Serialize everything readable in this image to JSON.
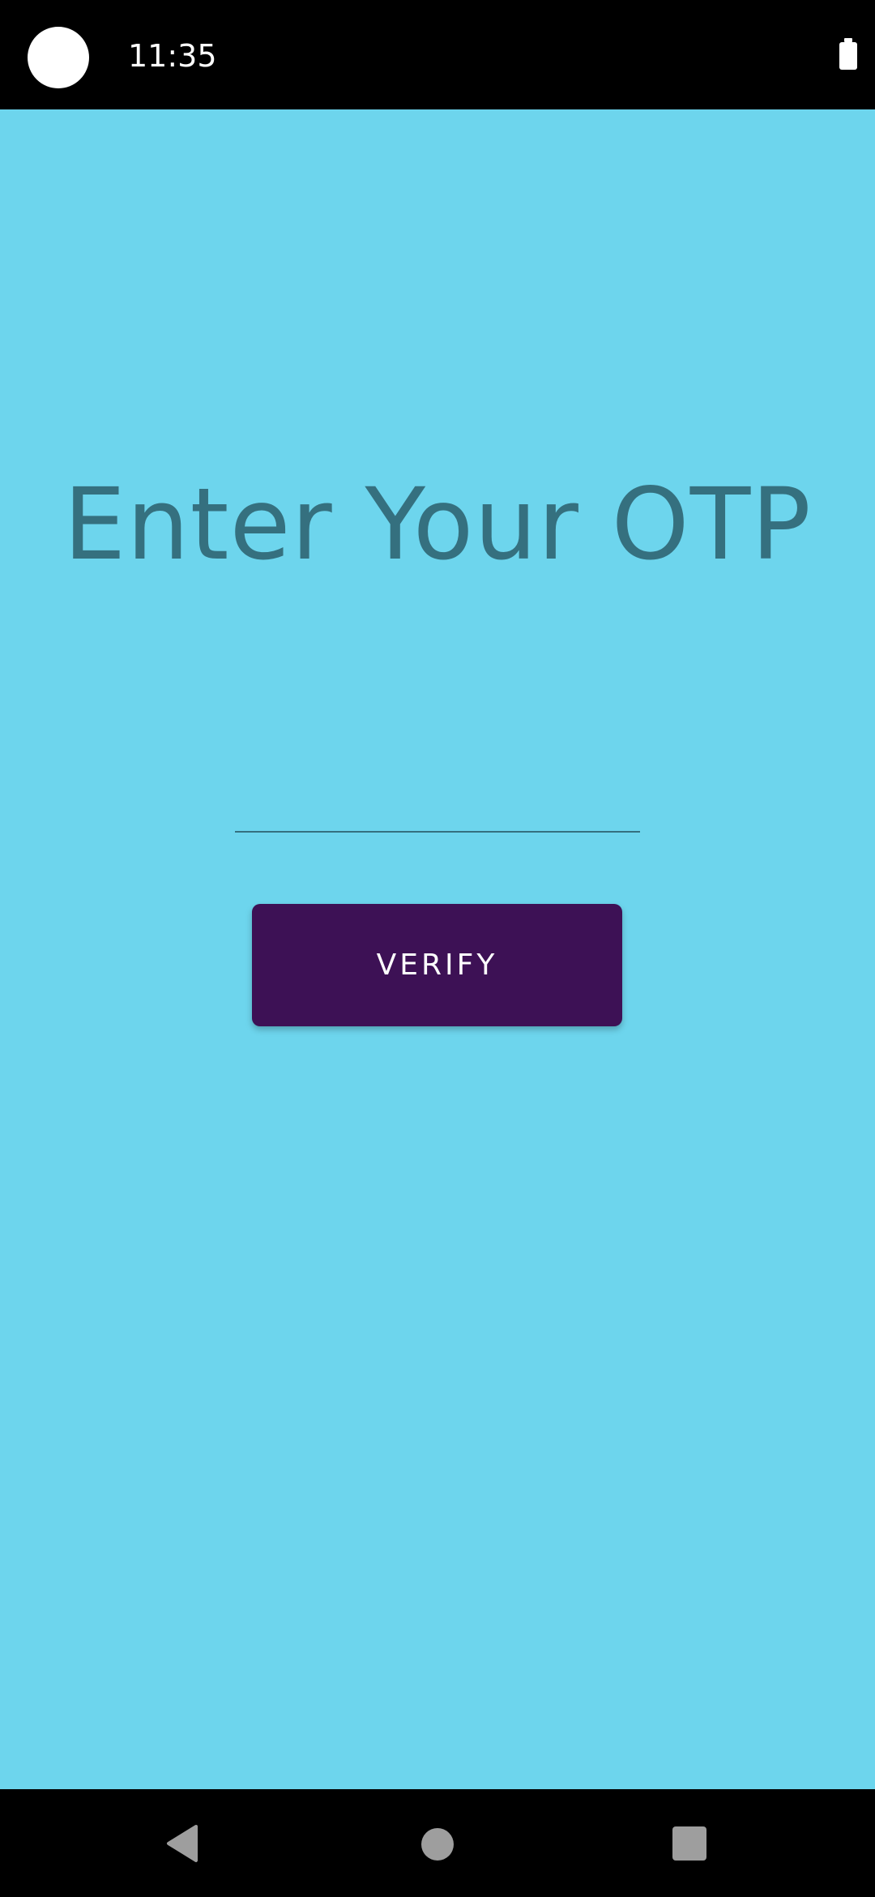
{
  "status_bar": {
    "time": "11:35",
    "icons": [
      "camera-dot-icon",
      "battery-icon"
    ]
  },
  "screen": {
    "title": "Enter Your OTP",
    "otp_input": {
      "value": "",
      "placeholder": ""
    },
    "verify_label": "VERIFY"
  },
  "nav_bar": {
    "icons": [
      "back-icon",
      "home-icon",
      "recents-icon"
    ]
  },
  "colors": {
    "background": "#6dd5ed",
    "title_text": "#35707f",
    "button": "#3d1155",
    "button_text": "#ffffff",
    "system_bars": "#000000"
  }
}
